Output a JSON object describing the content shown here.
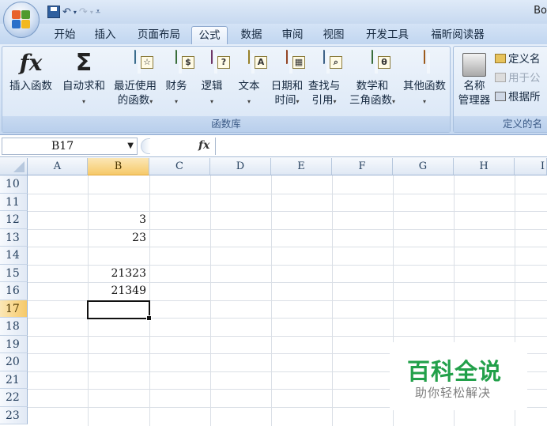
{
  "window": {
    "title_fragment": "Bo"
  },
  "ribbon_tabs": [
    {
      "label": "开始"
    },
    {
      "label": "插入"
    },
    {
      "label": "页面布局"
    },
    {
      "label": "公式"
    },
    {
      "label": "数据"
    },
    {
      "label": "审阅"
    },
    {
      "label": "视图"
    },
    {
      "label": "开发工具"
    },
    {
      "label": "福昕阅读器"
    }
  ],
  "active_tab": "公式",
  "ribbon": {
    "function_library": {
      "label": "函数库",
      "buttons": [
        {
          "line1": "插入函数",
          "line2": ""
        },
        {
          "line1": "自动求和",
          "line2": ""
        },
        {
          "line1": "最近使用",
          "line2": "的函数"
        },
        {
          "line1": "财务",
          "line2": ""
        },
        {
          "line1": "逻辑",
          "line2": ""
        },
        {
          "line1": "文本",
          "line2": ""
        },
        {
          "line1": "日期和",
          "line2": "时间"
        },
        {
          "line1": "查找与",
          "line2": "引用"
        },
        {
          "line1": "数学和",
          "line2": "三角函数"
        },
        {
          "line1": "其他函数",
          "line2": ""
        }
      ]
    },
    "defined_names": {
      "label": "定义的名",
      "name_manager": {
        "line1": "名称",
        "line2": "管理器"
      },
      "define_name": "定义名",
      "use_in_formula": "用于公",
      "create_from_selection": "根据所"
    }
  },
  "formula_bar": {
    "name_box": "B17",
    "fx_label": "fx",
    "formula": ""
  },
  "columns": [
    "A",
    "B",
    "C",
    "D",
    "E",
    "F",
    "G",
    "H",
    "I"
  ],
  "selected_column": "B",
  "rows": [
    {
      "num": "10",
      "b": ""
    },
    {
      "num": "11",
      "b": ""
    },
    {
      "num": "12",
      "b": "3"
    },
    {
      "num": "13",
      "b": "23"
    },
    {
      "num": "14",
      "b": ""
    },
    {
      "num": "15",
      "b": "21323"
    },
    {
      "num": "16",
      "b": "21349"
    },
    {
      "num": "17",
      "b": ""
    },
    {
      "num": "18",
      "b": ""
    },
    {
      "num": "19",
      "b": ""
    },
    {
      "num": "20",
      "b": ""
    },
    {
      "num": "21",
      "b": ""
    },
    {
      "num": "22",
      "b": ""
    },
    {
      "num": "23",
      "b": ""
    }
  ],
  "selected_row": "17",
  "watermark": {
    "title": "百科全说",
    "subtitle": "助你轻松解决"
  },
  "colors": {
    "accent": "#f6c969",
    "watermark_green": "#22a04a"
  }
}
